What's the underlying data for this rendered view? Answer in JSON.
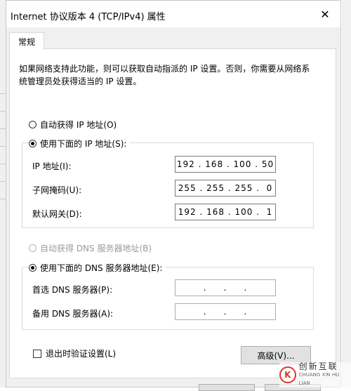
{
  "window": {
    "title": "Internet 协议版本 4 (TCP/IPv4) 属性",
    "close_glyph": "✕"
  },
  "tabs": [
    {
      "label": "常规"
    }
  ],
  "description": "如果网络支持此功能，则可以获取自动指派的 IP 设置。否则，你需要从网络系统管理员处获得适当的 IP 设置。",
  "ip_section": {
    "auto_label": "自动获得 IP 地址(O)",
    "manual_label": "使用下面的 IP 地址(S):",
    "selected": "manual",
    "fields": [
      {
        "label": "IP 地址(I):",
        "value": "192 . 168 . 100 . 50"
      },
      {
        "label": "子网掩码(U):",
        "value": "255 . 255 . 255 .  0"
      },
      {
        "label": "默认网关(D):",
        "value": "192 . 168 . 100 .  1"
      }
    ]
  },
  "dns_section": {
    "auto_label": "自动获得 DNS 服务器地址(B)",
    "manual_label": "使用下面的 DNS 服务器地址(E):",
    "selected": "manual",
    "fields": [
      {
        "label": "首选 DNS 服务器(P):",
        "value": "  .     .     .  "
      },
      {
        "label": "备用 DNS 服务器(A):",
        "value": "  .     .     .  "
      }
    ]
  },
  "validate_checkbox": {
    "label": "退出时验证设置(L)",
    "checked": false
  },
  "advanced_button": {
    "label": "高级(V)..."
  },
  "watermark": {
    "brand_cn": "创新互联",
    "brand_en": "CHUANG XIN HU LIAN",
    "logo_glyph": "K"
  }
}
